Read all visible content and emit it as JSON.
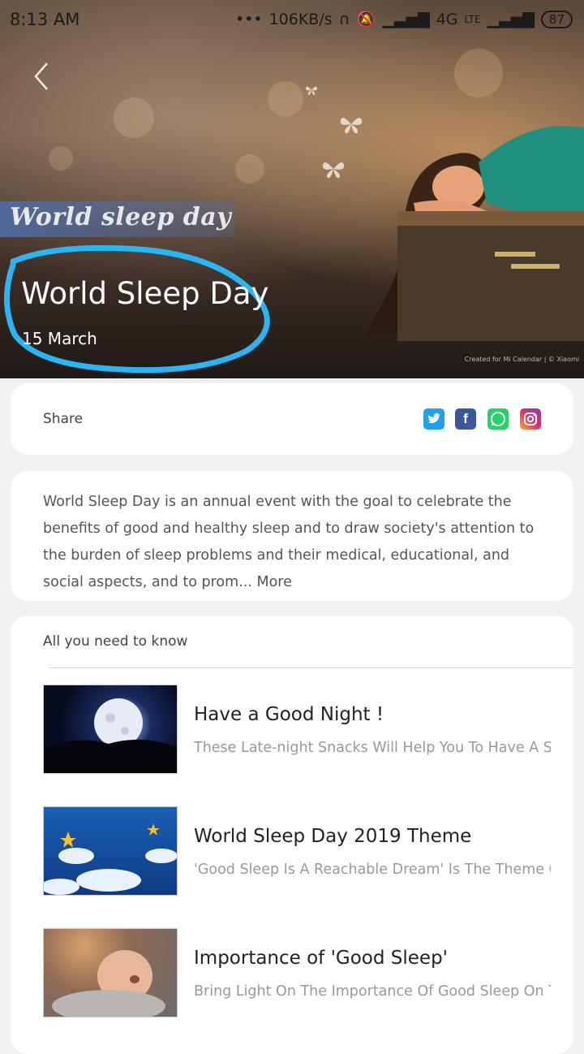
{
  "status_bar": {
    "time": "8:13 AM",
    "network_speed": "106KB/s",
    "network_type": "4G",
    "volte_label": "LTE",
    "battery": "87"
  },
  "hero": {
    "banner_text": "World sleep day",
    "title": "World Sleep Day",
    "date": "15 March",
    "credit": "Created for Mi Calendar  | © Xiaomi"
  },
  "share": {
    "label": "Share",
    "icons": [
      "twitter-icon",
      "facebook-icon",
      "whatsapp-icon",
      "instagram-icon"
    ]
  },
  "description": {
    "text": "World Sleep Day is an annual event with the goal to celebrate the benefits of good and healthy sleep and to draw society's attention to the burden of sleep problems and their medical, educational, and social aspects, and to prom...",
    "more_label": "More"
  },
  "know": {
    "title": "All you need to know",
    "articles": [
      {
        "title": "Have a Good Night !",
        "subtitle": "These Late-night Snacks Will Help You To Have A Soun..."
      },
      {
        "title": "World Sleep Day 2019 Theme",
        "subtitle": "'Good Sleep Is A Reachable Dream' Is The Theme Of Thi..."
      },
      {
        "title": "Importance of 'Good Sleep'",
        "subtitle": "Bring Light On The Importance Of Good Sleep On This ..."
      }
    ]
  },
  "colors": {
    "twitter": "#1da1f2",
    "facebook": "#3b5998",
    "whatsapp": "#25d366",
    "instagram": "#c13584",
    "annotation": "#29b6f6"
  }
}
